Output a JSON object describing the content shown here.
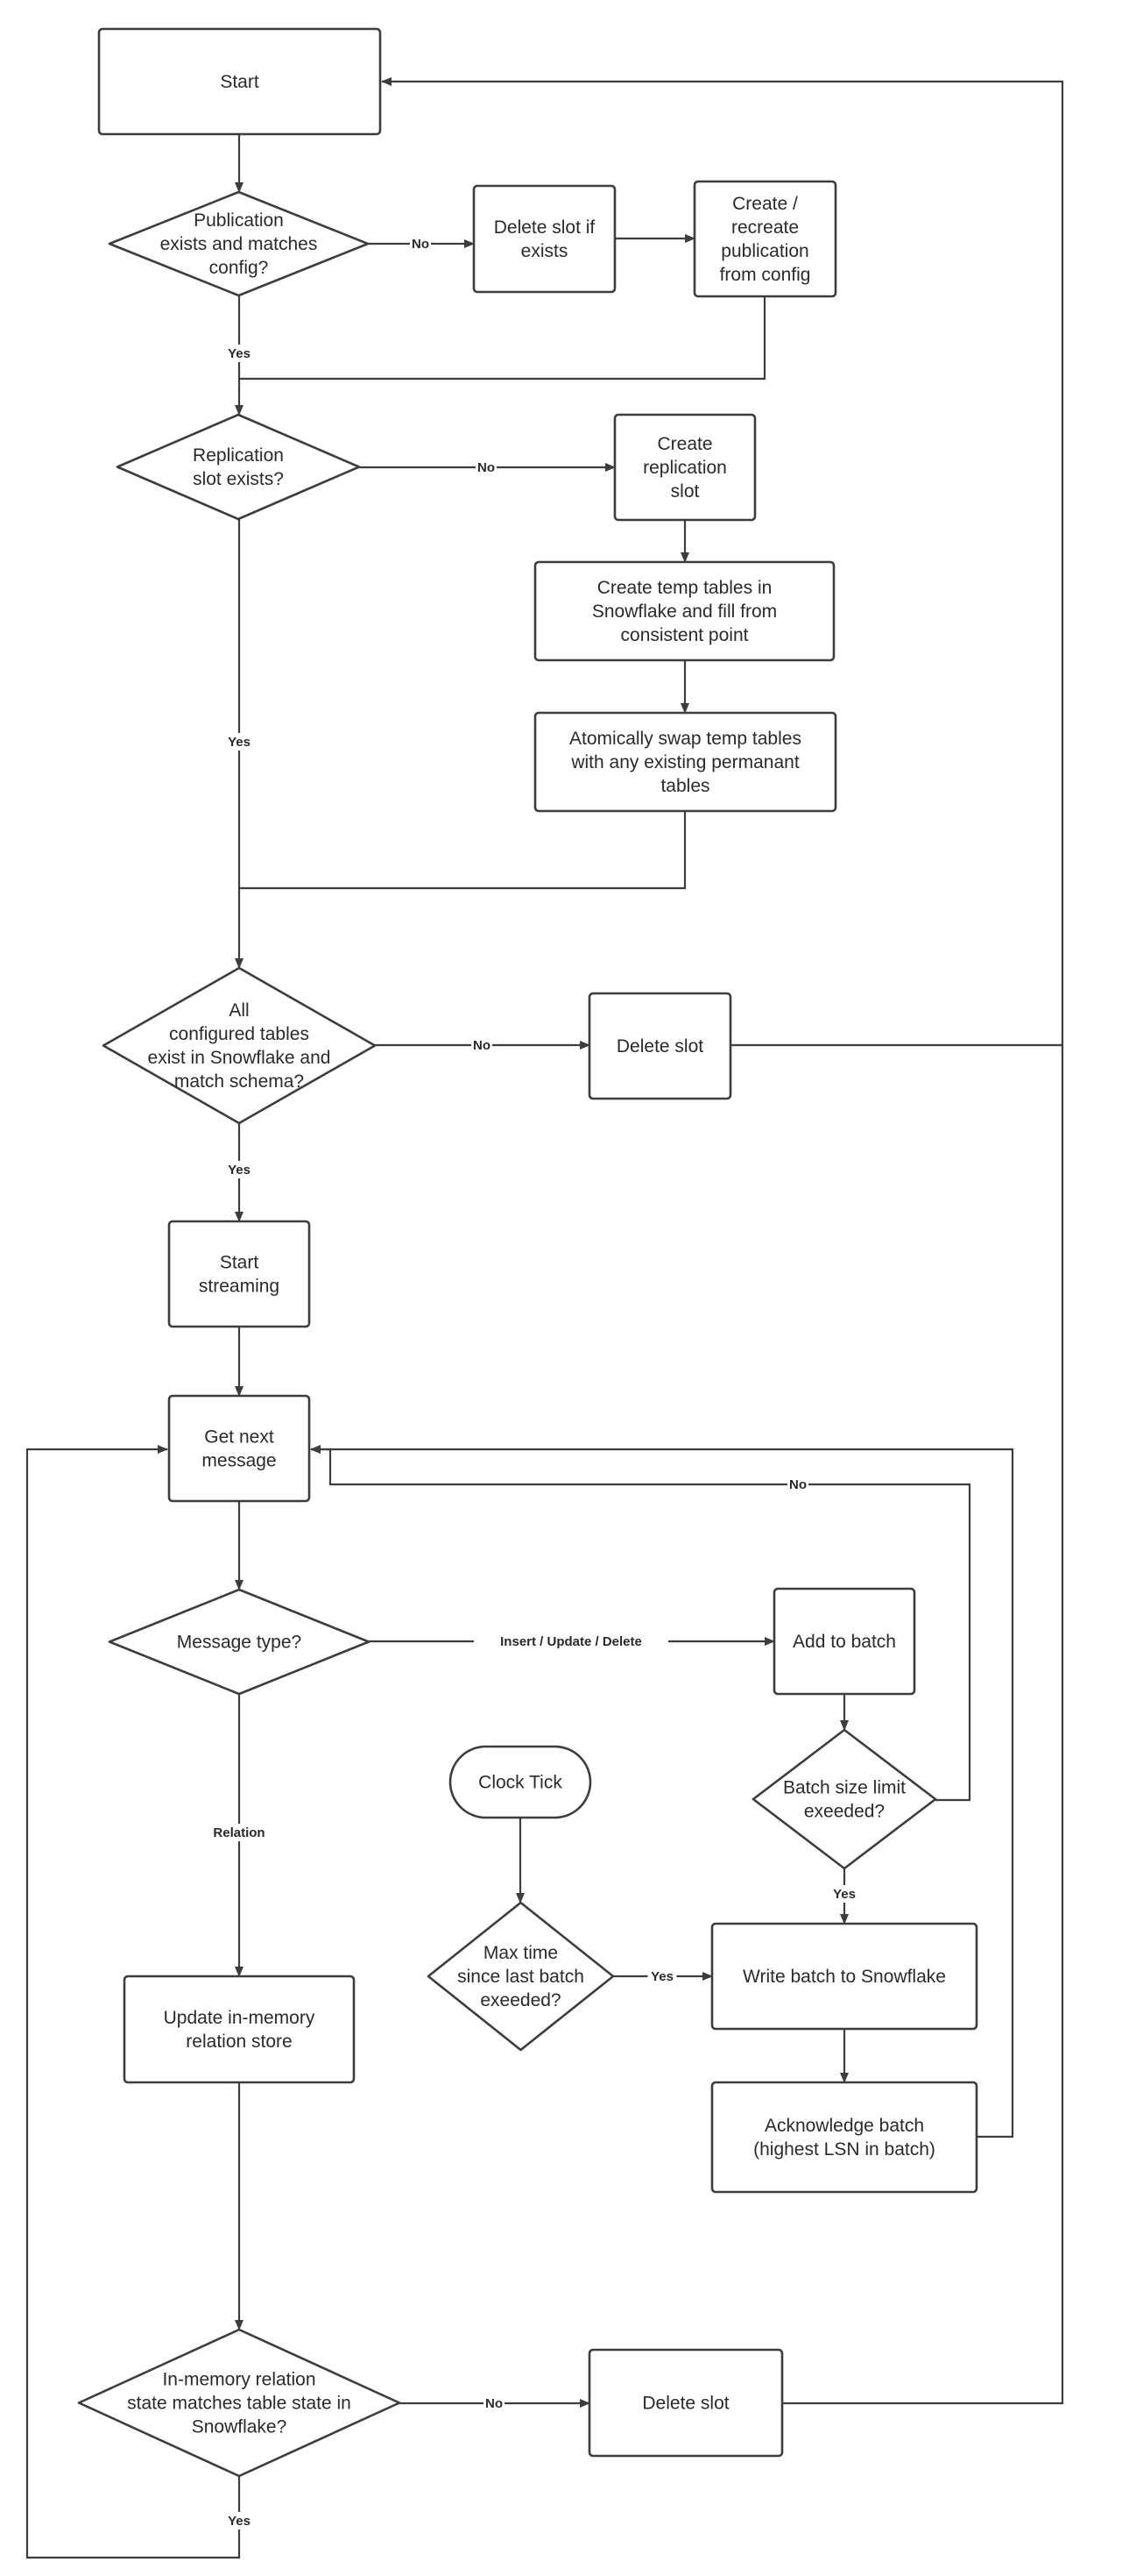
{
  "nodes": {
    "start": {
      "shape": "rect",
      "lines": [
        "Start"
      ]
    },
    "publication_check": {
      "shape": "diamond",
      "lines": [
        "Publication",
        "exists and matches",
        "config?"
      ]
    },
    "delete_slot_if_exists": {
      "shape": "rect",
      "lines": [
        "Delete slot if",
        "exists"
      ]
    },
    "recreate_publication": {
      "shape": "rect",
      "lines": [
        "Create /",
        "recreate",
        "publication",
        "from config"
      ]
    },
    "replication_slot_check": {
      "shape": "diamond",
      "lines": [
        "Replication",
        "slot exists?"
      ]
    },
    "create_replication_slot": {
      "shape": "rect",
      "lines": [
        "Create",
        "replication",
        "slot"
      ]
    },
    "create_temp_tables": {
      "shape": "rect",
      "lines": [
        "Create temp tables in",
        "Snowflake and fill from",
        "consistent point"
      ]
    },
    "swap_tables": {
      "shape": "rect",
      "lines": [
        "Atomically swap temp tables",
        "with any existing permanant",
        "tables"
      ]
    },
    "tables_check": {
      "shape": "diamond",
      "lines": [
        "All",
        "configured tables",
        "exist in Snowflake and",
        "match schema?"
      ]
    },
    "delete_slot_1": {
      "shape": "rect",
      "lines": [
        "Delete slot"
      ]
    },
    "start_streaming": {
      "shape": "rect",
      "lines": [
        "Start",
        "streaming"
      ]
    },
    "get_next_message": {
      "shape": "rect",
      "lines": [
        "Get next",
        "message"
      ]
    },
    "message_type": {
      "shape": "diamond",
      "lines": [
        "Message type?"
      ]
    },
    "add_to_batch": {
      "shape": "rect",
      "lines": [
        "Add to batch"
      ]
    },
    "clock_tick": {
      "shape": "terminator",
      "lines": [
        "Clock Tick"
      ]
    },
    "batch_size_check": {
      "shape": "diamond",
      "lines": [
        "Batch size limit",
        "exeeded?"
      ]
    },
    "max_time_check": {
      "shape": "diamond",
      "lines": [
        "Max time",
        "since last batch",
        "exeeded?"
      ]
    },
    "write_batch": {
      "shape": "rect",
      "lines": [
        "Write batch to Snowflake"
      ]
    },
    "acknowledge_batch": {
      "shape": "rect",
      "lines": [
        "Acknowledge batch",
        "(highest LSN in batch)"
      ]
    },
    "update_relation_store": {
      "shape": "rect",
      "lines": [
        "Update in-memory",
        "relation store"
      ]
    },
    "relation_state_check": {
      "shape": "diamond",
      "lines": [
        "In-memory relation",
        "state matches table state in",
        "Snowflake?"
      ]
    },
    "delete_slot_2": {
      "shape": "rect",
      "lines": [
        "Delete slot"
      ]
    }
  },
  "edge_labels": {
    "pub_no": "No",
    "pub_yes": "Yes",
    "slot_no": "No",
    "slot_yes": "Yes",
    "tables_no": "No",
    "tables_yes": "Yes",
    "msg_insert": "Insert / Update / Delete",
    "msg_relation": "Relation",
    "batch_no": "No",
    "batch_yes": "Yes",
    "time_yes": "Yes",
    "rel_no": "No",
    "rel_yes": "Yes"
  },
  "colors": {
    "stroke": "#3d3d3d",
    "text": "#2a2a2a",
    "background": "#ffffff"
  }
}
